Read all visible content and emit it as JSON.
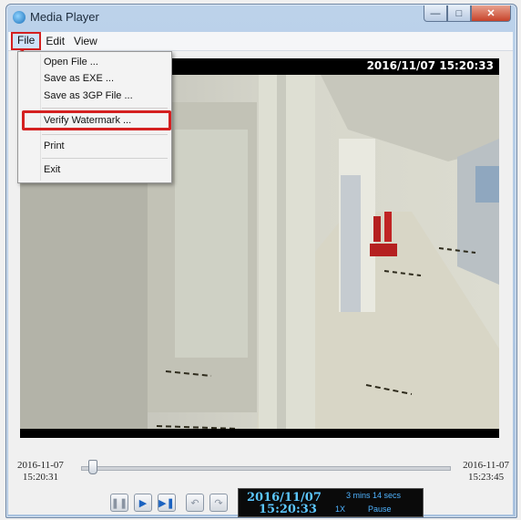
{
  "window": {
    "title": "Media Player",
    "minimize_icon": "minimize-icon",
    "maximize_icon": "maximize-icon",
    "close_icon": "close-icon"
  },
  "menubar": {
    "items": [
      "File",
      "Edit",
      "View"
    ]
  },
  "file_menu": {
    "items": [
      "Open File ...",
      "Save as EXE ...",
      "Save as 3GP File ...",
      "Verify Watermark ...",
      "Print",
      "Exit"
    ],
    "highlighted": "Verify Watermark ..."
  },
  "video": {
    "osd_timestamp": "2016/11/07 15:20:33"
  },
  "timeline": {
    "start_date": "2016-11-07",
    "start_time": "15:20:31",
    "end_date": "2016-11-07",
    "end_time": "15:23:45",
    "position_fraction": 0.02
  },
  "controls": {
    "buttons": [
      "pause-icon",
      "play-icon",
      "next-frame-icon",
      "rewind-icon",
      "fast-forward-icon"
    ]
  },
  "status": {
    "date": "2016/11/07",
    "time": "15:20:33",
    "duration": "3 mins 14 secs",
    "speed": "1X",
    "state": "Pause"
  },
  "colors": {
    "annotation_red": "#d42020",
    "status_text": "#5cc7ff"
  }
}
